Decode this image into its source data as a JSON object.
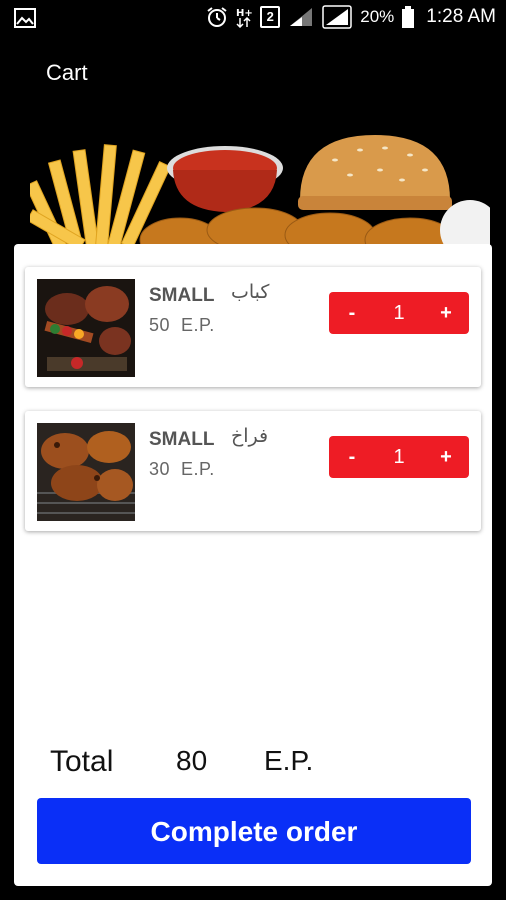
{
  "status_bar": {
    "network_badge": "2",
    "battery": "20%",
    "time": "1:28 AM",
    "icons": [
      "gallery-icon",
      "alarm-icon",
      "data-arrows-icon",
      "sim-badge-icon",
      "signal-icon",
      "signal-icon",
      "battery-icon"
    ]
  },
  "app": {
    "title": "Cart"
  },
  "cart": {
    "items": [
      {
        "size": "SMALL",
        "name": "كباب",
        "price": "50",
        "currency": "E.P.",
        "minus": "-",
        "qty": "1",
        "plus": "+"
      },
      {
        "size": "SMALL",
        "name": "فراخ",
        "price": "30",
        "currency": "E.P.",
        "minus": "-",
        "qty": "1",
        "plus": "+"
      }
    ]
  },
  "total": {
    "label": "Total",
    "value": "80",
    "currency": "E.P."
  },
  "actions": {
    "complete_label": "Complete order"
  },
  "colors": {
    "accent_red": "#ee1c25",
    "primary_blue": "#0a2ff7",
    "background": "#000000"
  }
}
